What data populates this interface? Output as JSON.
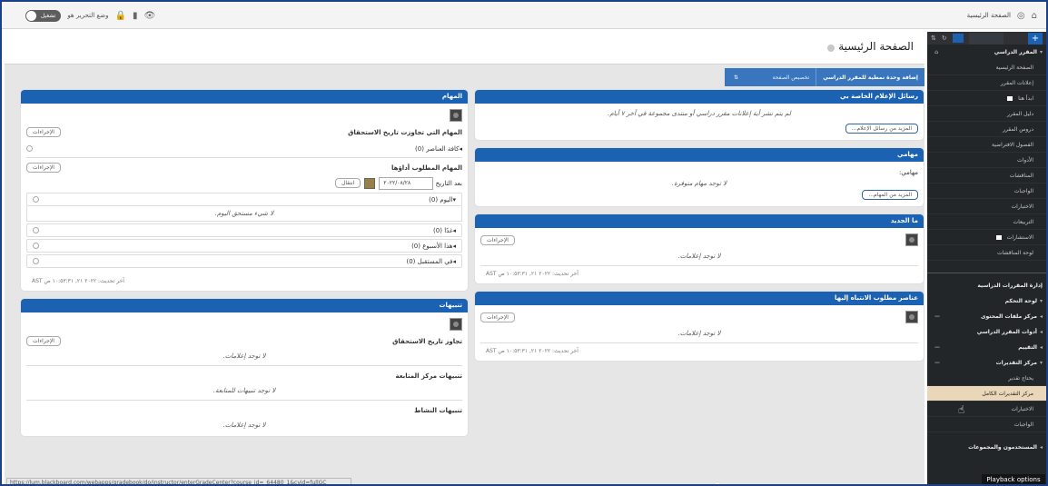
{
  "topbar": {
    "breadcrumb": "الصفحة الرئيسية",
    "edit_mode_label": "وضع التحرير هو",
    "edit_mode_value": "تشغيل"
  },
  "page": {
    "title": "الصفحة الرئيسية"
  },
  "actionbar": {
    "add_content": "إضافة وحدة نمطية للمقرر الدراسي",
    "customize": "تخصيص الصفحة",
    "sort_icon": "⇅"
  },
  "modules": {
    "my_announcements": {
      "title": "رسائل الإعلام الخاصة بي",
      "empty": "لم يتم نشر أية إعلانات مقرر دراسي أو منتدى مجموعة في آخر ٧ أيام.",
      "more": "المزيد من رسائل الإعلام..."
    },
    "my_tasks": {
      "title": "مهامي",
      "label": "مهامي:",
      "empty": "لا توجد مهام متوفرة.",
      "more": "المزيد من المهام..."
    },
    "whats_new": {
      "title": "ما الجديد",
      "actions": "الإجراءات",
      "empty": "لا توجد إعلامات.",
      "footer": "آخر تحديث: ٢٠٢٢ ٢١, ١٠:٥٣:٣١ ص AST"
    },
    "needs_attention": {
      "title": "عناصر مطلوب الانتباه إليها",
      "actions": "الإجراءات",
      "empty": "لا توجد إعلامات.",
      "footer": "آخر تحديث: ٢٠٢٢ ٢١, ١٠:٥٣:٣١ ص AST"
    },
    "tasks": {
      "title": "المهام",
      "overdue": "المهام التي تجاوزت تاريخ الاستحقاق",
      "actions": "الإجراءات",
      "all_items": "كافة العناصر",
      "all_count": "(0)",
      "due": "المهام المطلوب أداؤها",
      "date_label": "بعد التاريخ",
      "date_value": "٢٠٢٢/٠٨/٢٨",
      "go": "انتقال",
      "today": "اليوم",
      "today_count": "(0)",
      "nothing_today": "لا شيء مستحق اليوم.",
      "tomorrow": "غدًا",
      "tomorrow_count": "(0)",
      "this_week": "هذا الأسبوع",
      "this_week_count": "(0)",
      "future": "في المستقبل",
      "future_count": "(0)",
      "footer": "آخر تحديث: ٢٠٢٢ ٢١, ١٠:٥٣:٣١ ص AST"
    },
    "alerts": {
      "title": "تنبيهات",
      "past_due": "تجاوز تاريخ الاستحقاق",
      "actions": "الإجراءات",
      "empty1": "لا توجد إعلامات.",
      "retention": "تنبيهات مركز المتابعة",
      "empty2": "لا توجد تنبيهات للمتابعة.",
      "activity": "تنبيهات النشاط",
      "empty3": "لا توجد إعلامات."
    }
  },
  "sidebar": {
    "course_title": "المقرر الدراسي",
    "items": [
      "الصفحة الرئيسية",
      "إعلانات المقرر",
      "ابدأ هنا",
      "دليل المقرر",
      "دروس المقرر",
      "الفصول الافتراضية",
      "الأدوات",
      "المناقشات",
      "الواجبات",
      "الاختبارات",
      "التربيعات",
      "الاستشارات",
      "لوحة المناقشات"
    ],
    "management_title": "إدارة المقررات الدراسية",
    "control_panel": "لوحة التحكم",
    "content_collection": "مركز ملفات المحتوى",
    "course_tools": "أدوات المقرر الدراسي",
    "evaluation": "التقييم",
    "grade_center": "مركز التقديرات",
    "grade_items": [
      "يحتاج تقدير",
      "مركز التقديرات الكامل",
      "الاختبارات",
      "الواجبات"
    ],
    "users_groups": "المستخدمون والمجموعات"
  },
  "status_url": "https://lum.blackboard.com/webapps/gradebook/do/instructor/enterGradeCenter?course_id=_64480_1&cvid=fullGC",
  "playback": "Playback options"
}
